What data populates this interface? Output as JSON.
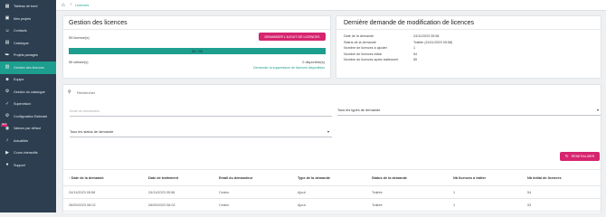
{
  "sidebar": {
    "items": [
      {
        "label": "Tableau de bord",
        "icon": "dashboard-icon",
        "glyph": "▦"
      },
      {
        "label": "Mes projets",
        "icon": "projects-icon",
        "glyph": "▣"
      },
      {
        "label": "Contacts",
        "icon": "contacts-icon",
        "glyph": "☺"
      },
      {
        "label": "Catalogue",
        "icon": "catalog-icon",
        "glyph": "▤"
      },
      {
        "label": "Projets partagés",
        "icon": "share-icon",
        "glyph": "⮩"
      },
      {
        "label": "Gestion des licences",
        "icon": "license-icon",
        "glyph": "▧"
      },
      {
        "label": "Equipe",
        "icon": "team-icon",
        "glyph": "☻"
      },
      {
        "label": "Gestion du catalogue",
        "icon": "catalog-settings-icon",
        "glyph": "⚙"
      },
      {
        "label": "Supervision",
        "icon": "supervision-icon",
        "glyph": "✓"
      },
      {
        "label": "Configuration Estimate",
        "icon": "estimate-config-icon",
        "glyph": "⚙"
      },
      {
        "label": "Valeurs par défaut",
        "icon": "defaults-icon",
        "glyph": "◉"
      },
      {
        "label": "Actualités",
        "icon": "news-icon",
        "glyph": "♪"
      },
      {
        "label": "Cours interactifs",
        "icon": "courses-icon",
        "glyph": "▶"
      },
      {
        "label": "Support",
        "icon": "support-icon",
        "glyph": "●"
      }
    ],
    "active_index": 5,
    "new_badge": "NEW"
  },
  "breadcrumb": {
    "current": "Licences"
  },
  "license_card": {
    "title": "Gestion des licences",
    "licence_count": "55 licence(s)",
    "add_button": "DEMANDER L'AJOUT DE LICENCES",
    "progress_label": "55 / 55",
    "progress_fraction": 1.0,
    "used": "55 utilisée(s)",
    "available": "0 disponible(s)",
    "remove_link": "Demander la suppression de licences disponibles"
  },
  "last_request": {
    "title": "Dernière demande de modification de licences",
    "rows": [
      {
        "label": "Date de la demande",
        "value": "24/11/2023 05:58"
      },
      {
        "label": "Status de la demande",
        "value": "Traitée (24/11/2023 05:58)"
      },
      {
        "label": "Nombre de licences à ajouter",
        "value": "1"
      },
      {
        "label": "Nombre de licences initial",
        "value": "54"
      },
      {
        "label": "Nombre de licences après traitement",
        "value": "55"
      }
    ]
  },
  "filters": {
    "search_placeholder": "Rechercher",
    "email_placeholder": "Email du demandeur",
    "types_select": "Tous les types de demande",
    "status_select": "Tous les status de demande",
    "reset_button": "RÉINITIALISER"
  },
  "table": {
    "headers": [
      "Date de la demande",
      "Date de traitement",
      "Email du demandeur",
      "Type de la demande",
      "Status de la demande",
      "Nb licences à traiter",
      "Nb initial de licences"
    ],
    "sort_indicator": "↑",
    "rows": [
      [
        "24/11/2023 05:58",
        "24/11/2023 05:58",
        "Cedeo",
        "Ajout",
        "Traitée",
        "1",
        "54"
      ],
      [
        "26/09/2023 08:02",
        "26/09/2023 08:02",
        "Cedeo",
        "Ajout",
        "Traitée",
        "1",
        "53"
      ]
    ]
  },
  "colors": {
    "sidebar_bg": "#2c3e50",
    "accent_teal": "#1d9e8e",
    "accent_pink": "#d6246e"
  }
}
